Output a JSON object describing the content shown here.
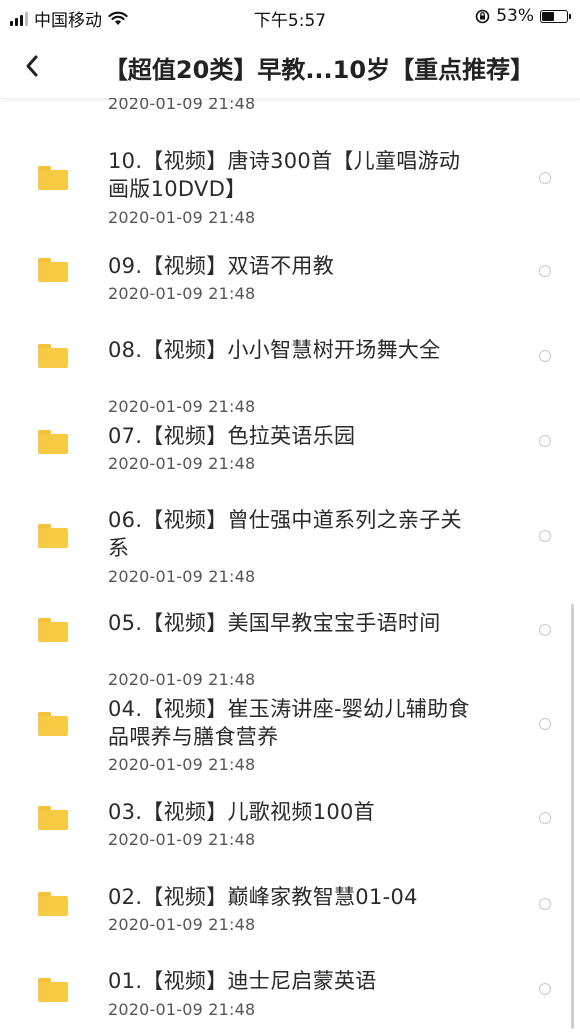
{
  "status_bar": {
    "carrier": "中国移动",
    "time": "下午5:57",
    "battery": "53%",
    "battery_level": 0.53
  },
  "nav": {
    "back_icon": "chevron-left-icon",
    "title": "【超值20类】早教...10岁【重点推荐】"
  },
  "list": {
    "top_partial_date": "2020-01-09 21:48",
    "items": [
      {
        "title": "10.【视频】唐诗300首【儿童唱游动画版10DVD】",
        "date": "2020-01-09 21:48"
      },
      {
        "title": "09.【视频】双语不用教",
        "date": "2020-01-09 21:48"
      },
      {
        "title": "08.【视频】小小智慧树开场舞大全",
        "date": "2020-01-09 21:48"
      },
      {
        "title": "07.【视频】色拉英语乐园",
        "date": "2020-01-09 21:48"
      },
      {
        "title": "06.【视频】曾仕强中道系列之亲子关系",
        "date": "2020-01-09 21:48"
      },
      {
        "title": "05.【视频】美国早教宝宝手语时间",
        "date": "2020-01-09 21:48"
      },
      {
        "title": "04.【视频】崔玉涛讲座-婴幼儿辅助食品喂养与膳食营养",
        "date": "2020-01-09 21:48"
      },
      {
        "title": "03.【视频】儿歌视频100首",
        "date": "2020-01-09 21:48"
      },
      {
        "title": "02.【视频】巅峰家教智慧01-04",
        "date": "2020-01-09 21:48"
      },
      {
        "title": "01.【视频】迪士尼启蒙英语",
        "date": "2020-01-09 21:48"
      }
    ]
  },
  "colors": {
    "folder": "#f7ca45",
    "folder_tab": "#f4c239"
  }
}
